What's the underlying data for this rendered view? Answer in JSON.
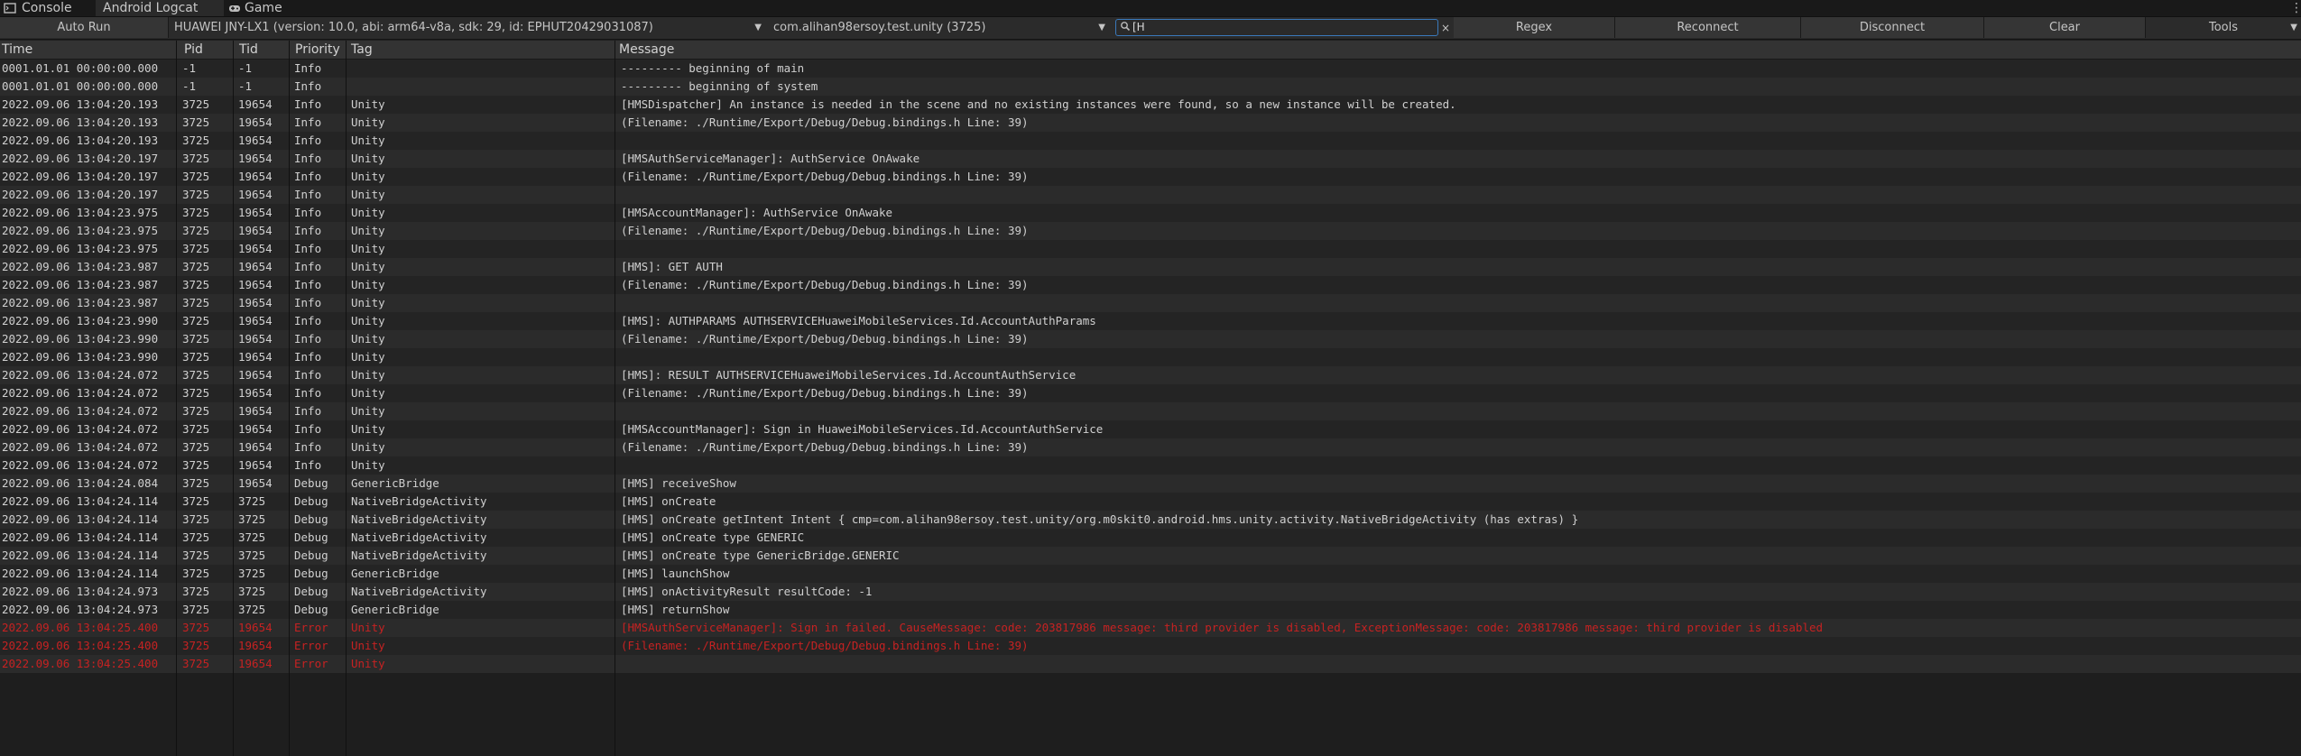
{
  "tabs": [
    {
      "label": "Console",
      "icon": "console-icon"
    },
    {
      "label": "Android Logcat",
      "icon": "logcat-icon"
    },
    {
      "label": "Game",
      "icon": "gamepad-icon"
    }
  ],
  "toolbar": {
    "auto_run": "Auto Run",
    "device": "HUAWEI JNY-LX1 (version: 10.0, abi: arm64-v8a, sdk: 29, id: EPHUT20429031087)",
    "package": "com.alihan98ersoy.test.unity (3725)",
    "search_value": "[H",
    "regex": "Regex",
    "reconnect": "Reconnect",
    "disconnect": "Disconnect",
    "clear": "Clear",
    "tools": "Tools"
  },
  "columns": {
    "time": "Time",
    "pid": "Pid",
    "tid": "Tid",
    "priority": "Priority",
    "tag": "Tag",
    "message": "Message"
  },
  "colors": {
    "error": "#c62222",
    "search_border": "#3a79bb"
  },
  "rows": [
    {
      "time": "0001.01.01 00:00:00.000",
      "pid": "-1",
      "tid": "-1",
      "priority": "Info",
      "tag": "",
      "message": "--------- beginning of main"
    },
    {
      "time": "0001.01.01 00:00:00.000",
      "pid": "-1",
      "tid": "-1",
      "priority": "Info",
      "tag": "",
      "message": "--------- beginning of system"
    },
    {
      "time": "2022.09.06 13:04:20.193",
      "pid": "3725",
      "tid": "19654",
      "priority": "Info",
      "tag": "Unity",
      "message": "[HMSDispatcher] An instance is needed in the scene and no existing instances were found, so a new instance will be created."
    },
    {
      "time": "2022.09.06 13:04:20.193",
      "pid": "3725",
      "tid": "19654",
      "priority": "Info",
      "tag": "Unity",
      "message": "(Filename: ./Runtime/Export/Debug/Debug.bindings.h Line: 39)"
    },
    {
      "time": "2022.09.06 13:04:20.193",
      "pid": "3725",
      "tid": "19654",
      "priority": "Info",
      "tag": "Unity",
      "message": ""
    },
    {
      "time": "2022.09.06 13:04:20.197",
      "pid": "3725",
      "tid": "19654",
      "priority": "Info",
      "tag": "Unity",
      "message": "[HMSAuthServiceManager]: AuthService OnAwake"
    },
    {
      "time": "2022.09.06 13:04:20.197",
      "pid": "3725",
      "tid": "19654",
      "priority": "Info",
      "tag": "Unity",
      "message": "(Filename: ./Runtime/Export/Debug/Debug.bindings.h Line: 39)"
    },
    {
      "time": "2022.09.06 13:04:20.197",
      "pid": "3725",
      "tid": "19654",
      "priority": "Info",
      "tag": "Unity",
      "message": ""
    },
    {
      "time": "2022.09.06 13:04:23.975",
      "pid": "3725",
      "tid": "19654",
      "priority": "Info",
      "tag": "Unity",
      "message": "[HMSAccountManager]: AuthService OnAwake"
    },
    {
      "time": "2022.09.06 13:04:23.975",
      "pid": "3725",
      "tid": "19654",
      "priority": "Info",
      "tag": "Unity",
      "message": "(Filename: ./Runtime/Export/Debug/Debug.bindings.h Line: 39)"
    },
    {
      "time": "2022.09.06 13:04:23.975",
      "pid": "3725",
      "tid": "19654",
      "priority": "Info",
      "tag": "Unity",
      "message": ""
    },
    {
      "time": "2022.09.06 13:04:23.987",
      "pid": "3725",
      "tid": "19654",
      "priority": "Info",
      "tag": "Unity",
      "message": "[HMS]: GET AUTH"
    },
    {
      "time": "2022.09.06 13:04:23.987",
      "pid": "3725",
      "tid": "19654",
      "priority": "Info",
      "tag": "Unity",
      "message": "(Filename: ./Runtime/Export/Debug/Debug.bindings.h Line: 39)"
    },
    {
      "time": "2022.09.06 13:04:23.987",
      "pid": "3725",
      "tid": "19654",
      "priority": "Info",
      "tag": "Unity",
      "message": ""
    },
    {
      "time": "2022.09.06 13:04:23.990",
      "pid": "3725",
      "tid": "19654",
      "priority": "Info",
      "tag": "Unity",
      "message": "[HMS]: AUTHPARAMS AUTHSERVICEHuaweiMobileServices.Id.AccountAuthParams"
    },
    {
      "time": "2022.09.06 13:04:23.990",
      "pid": "3725",
      "tid": "19654",
      "priority": "Info",
      "tag": "Unity",
      "message": "(Filename: ./Runtime/Export/Debug/Debug.bindings.h Line: 39)"
    },
    {
      "time": "2022.09.06 13:04:23.990",
      "pid": "3725",
      "tid": "19654",
      "priority": "Info",
      "tag": "Unity",
      "message": ""
    },
    {
      "time": "2022.09.06 13:04:24.072",
      "pid": "3725",
      "tid": "19654",
      "priority": "Info",
      "tag": "Unity",
      "message": "[HMS]: RESULT AUTHSERVICEHuaweiMobileServices.Id.AccountAuthService"
    },
    {
      "time": "2022.09.06 13:04:24.072",
      "pid": "3725",
      "tid": "19654",
      "priority": "Info",
      "tag": "Unity",
      "message": "(Filename: ./Runtime/Export/Debug/Debug.bindings.h Line: 39)"
    },
    {
      "time": "2022.09.06 13:04:24.072",
      "pid": "3725",
      "tid": "19654",
      "priority": "Info",
      "tag": "Unity",
      "message": ""
    },
    {
      "time": "2022.09.06 13:04:24.072",
      "pid": "3725",
      "tid": "19654",
      "priority": "Info",
      "tag": "Unity",
      "message": "[HMSAccountManager]: Sign in HuaweiMobileServices.Id.AccountAuthService"
    },
    {
      "time": "2022.09.06 13:04:24.072",
      "pid": "3725",
      "tid": "19654",
      "priority": "Info",
      "tag": "Unity",
      "message": "(Filename: ./Runtime/Export/Debug/Debug.bindings.h Line: 39)"
    },
    {
      "time": "2022.09.06 13:04:24.072",
      "pid": "3725",
      "tid": "19654",
      "priority": "Info",
      "tag": "Unity",
      "message": ""
    },
    {
      "time": "2022.09.06 13:04:24.084",
      "pid": "3725",
      "tid": "19654",
      "priority": "Debug",
      "tag": "GenericBridge",
      "message": "[HMS] receiveShow"
    },
    {
      "time": "2022.09.06 13:04:24.114",
      "pid": "3725",
      "tid": "3725",
      "priority": "Debug",
      "tag": "NativeBridgeActivity",
      "message": "[HMS] onCreate"
    },
    {
      "time": "2022.09.06 13:04:24.114",
      "pid": "3725",
      "tid": "3725",
      "priority": "Debug",
      "tag": "NativeBridgeActivity",
      "message": "[HMS] onCreate getIntent Intent { cmp=com.alihan98ersoy.test.unity/org.m0skit0.android.hms.unity.activity.NativeBridgeActivity (has extras) }"
    },
    {
      "time": "2022.09.06 13:04:24.114",
      "pid": "3725",
      "tid": "3725",
      "priority": "Debug",
      "tag": "NativeBridgeActivity",
      "message": "[HMS] onCreate type GENERIC"
    },
    {
      "time": "2022.09.06 13:04:24.114",
      "pid": "3725",
      "tid": "3725",
      "priority": "Debug",
      "tag": "NativeBridgeActivity",
      "message": "[HMS] onCreate type GenericBridge.GENERIC"
    },
    {
      "time": "2022.09.06 13:04:24.114",
      "pid": "3725",
      "tid": "3725",
      "priority": "Debug",
      "tag": "GenericBridge",
      "message": "[HMS] launchShow"
    },
    {
      "time": "2022.09.06 13:04:24.973",
      "pid": "3725",
      "tid": "3725",
      "priority": "Debug",
      "tag": "NativeBridgeActivity",
      "message": "[HMS] onActivityResult resultCode: -1"
    },
    {
      "time": "2022.09.06 13:04:24.973",
      "pid": "3725",
      "tid": "3725",
      "priority": "Debug",
      "tag": "GenericBridge",
      "message": "[HMS] returnShow"
    },
    {
      "time": "2022.09.06 13:04:25.400",
      "pid": "3725",
      "tid": "19654",
      "priority": "Error",
      "tag": "Unity",
      "message": "[HMSAuthServiceManager]: Sign in failed. CauseMessage:  code: 203817986 message: third provider is disabled, ExceptionMessage:  code: 203817986 message: third provider is disabled"
    },
    {
      "time": "2022.09.06 13:04:25.400",
      "pid": "3725",
      "tid": "19654",
      "priority": "Error",
      "tag": "Unity",
      "message": "(Filename: ./Runtime/Export/Debug/Debug.bindings.h Line: 39)"
    },
    {
      "time": "2022.09.06 13:04:25.400",
      "pid": "3725",
      "tid": "19654",
      "priority": "Error",
      "tag": "Unity",
      "message": ""
    }
  ]
}
